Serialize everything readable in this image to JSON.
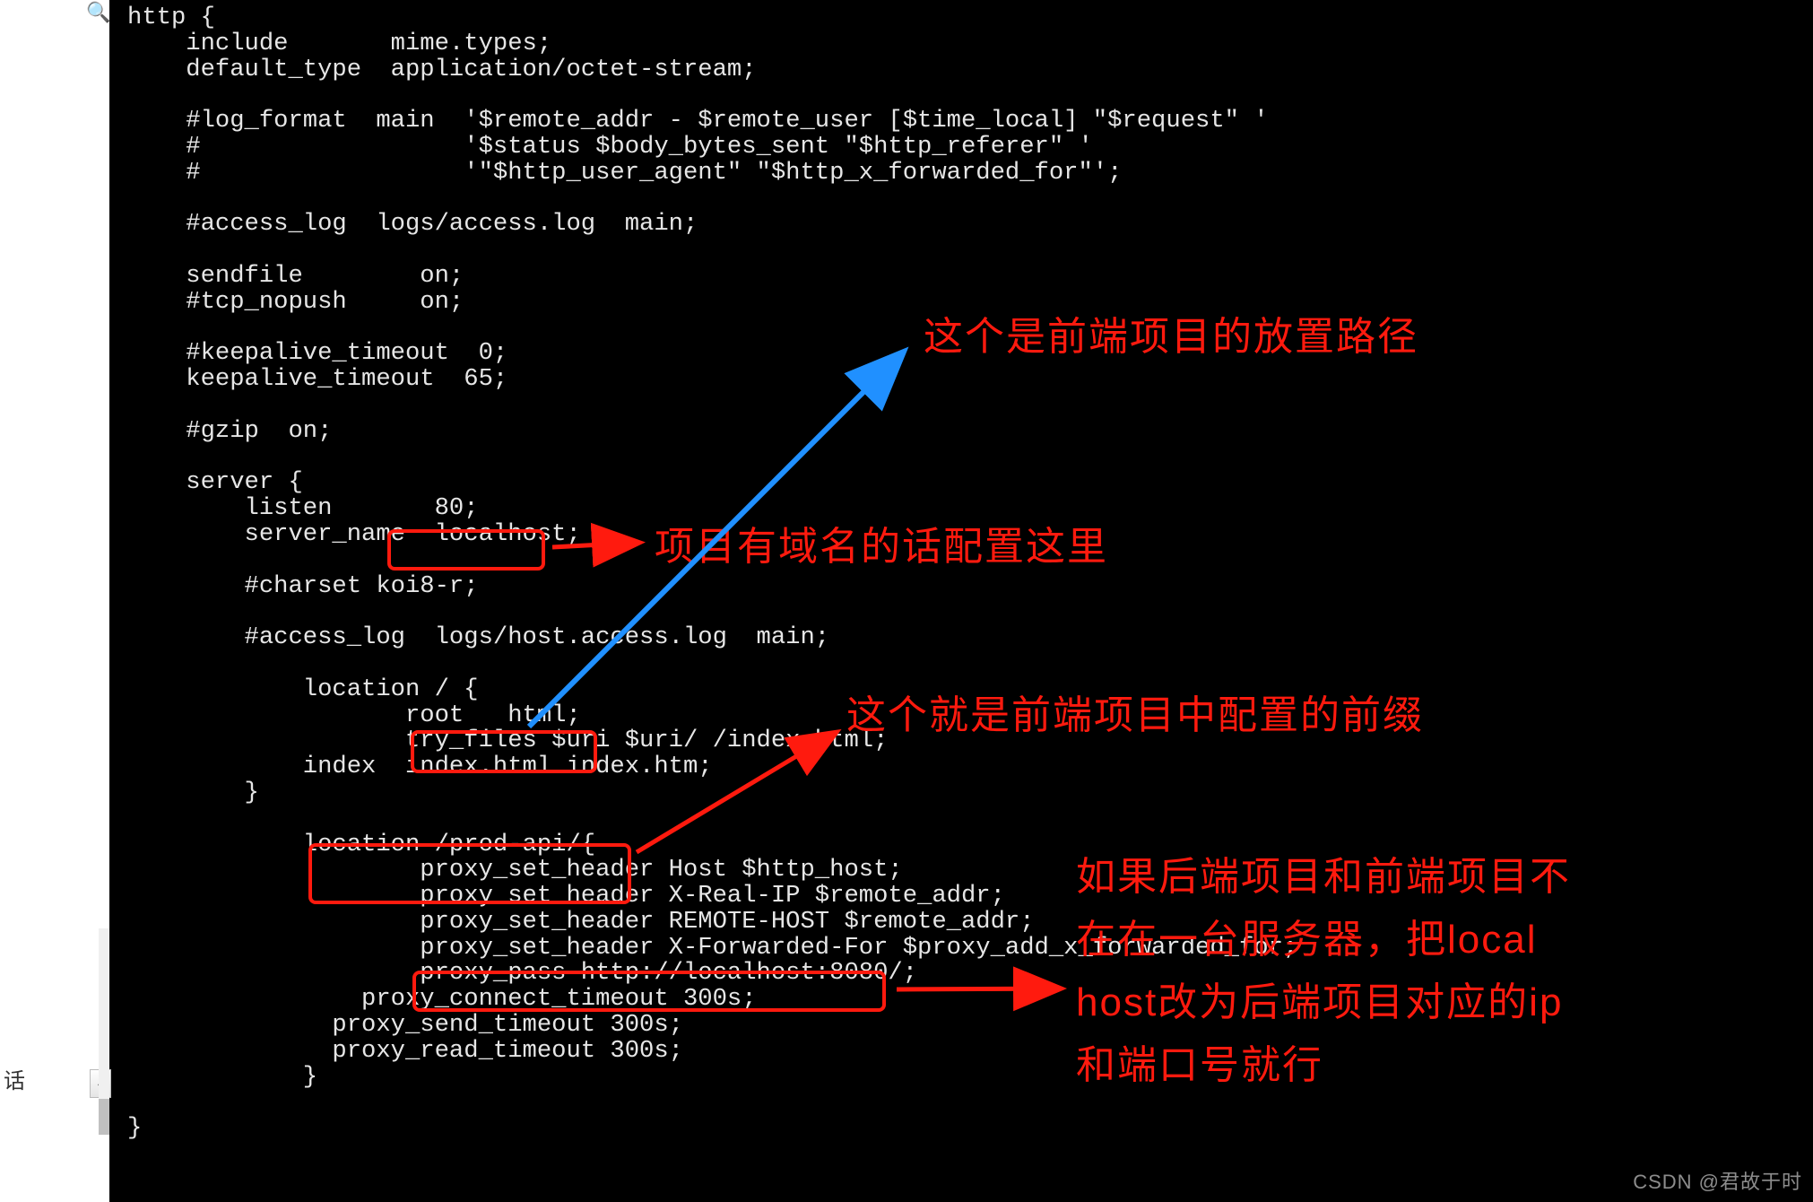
{
  "left_side": {
    "search_icon": "🔍",
    "bottom_char": "话",
    "dropdown_caret": "⌄"
  },
  "annotations": {
    "frontend_path": "这个是前端项目的放置路径",
    "server_name_note": "项目有域名的话配置这里",
    "prefix_note": "这个就是前端项目中配置的前缀",
    "backend_note_l1": "如果后端项目和前端项目不",
    "backend_note_l2": "在在一台服务器，把local",
    "backend_note_l3": "host改为后端项目对应的ip",
    "backend_note_l4": "和端口号就行"
  },
  "code": "http {\n    include       mime.types;\n    default_type  application/octet-stream;\n\n    #log_format  main  '$remote_addr - $remote_user [$time_local] \"$request\" '\n    #                  '$status $body_bytes_sent \"$http_referer\" '\n    #                  '\"$http_user_agent\" \"$http_x_forwarded_for\"';\n\n    #access_log  logs/access.log  main;\n\n    sendfile        on;\n    #tcp_nopush     on;\n\n    #keepalive_timeout  0;\n    keepalive_timeout  65;\n\n    #gzip  on;\n\n    server {\n        listen       80;\n        server_name  localhost;\n\n        #charset koi8-r;\n\n        #access_log  logs/host.access.log  main;\n\n            location / {\n                   root   html;\n                   try_files $uri $uri/ /index.html;\n            index  index.html index.htm;\n        }\n\n            location /prod-api/{\n                    proxy_set_header Host $http_host;\n                    proxy_set_header X-Real-IP $remote_addr;\n                    proxy_set_header REMOTE-HOST $remote_addr;\n                    proxy_set_header X-Forwarded-For $proxy_add_x_forwarded_for;\n                    proxy_pass http://localhost:8080/;\n                proxy_connect_timeout 300s;\n              proxy_send_timeout 300s;\n              proxy_read_timeout 300s;\n            }\n\n}",
  "watermark": "CSDN @君故于时"
}
